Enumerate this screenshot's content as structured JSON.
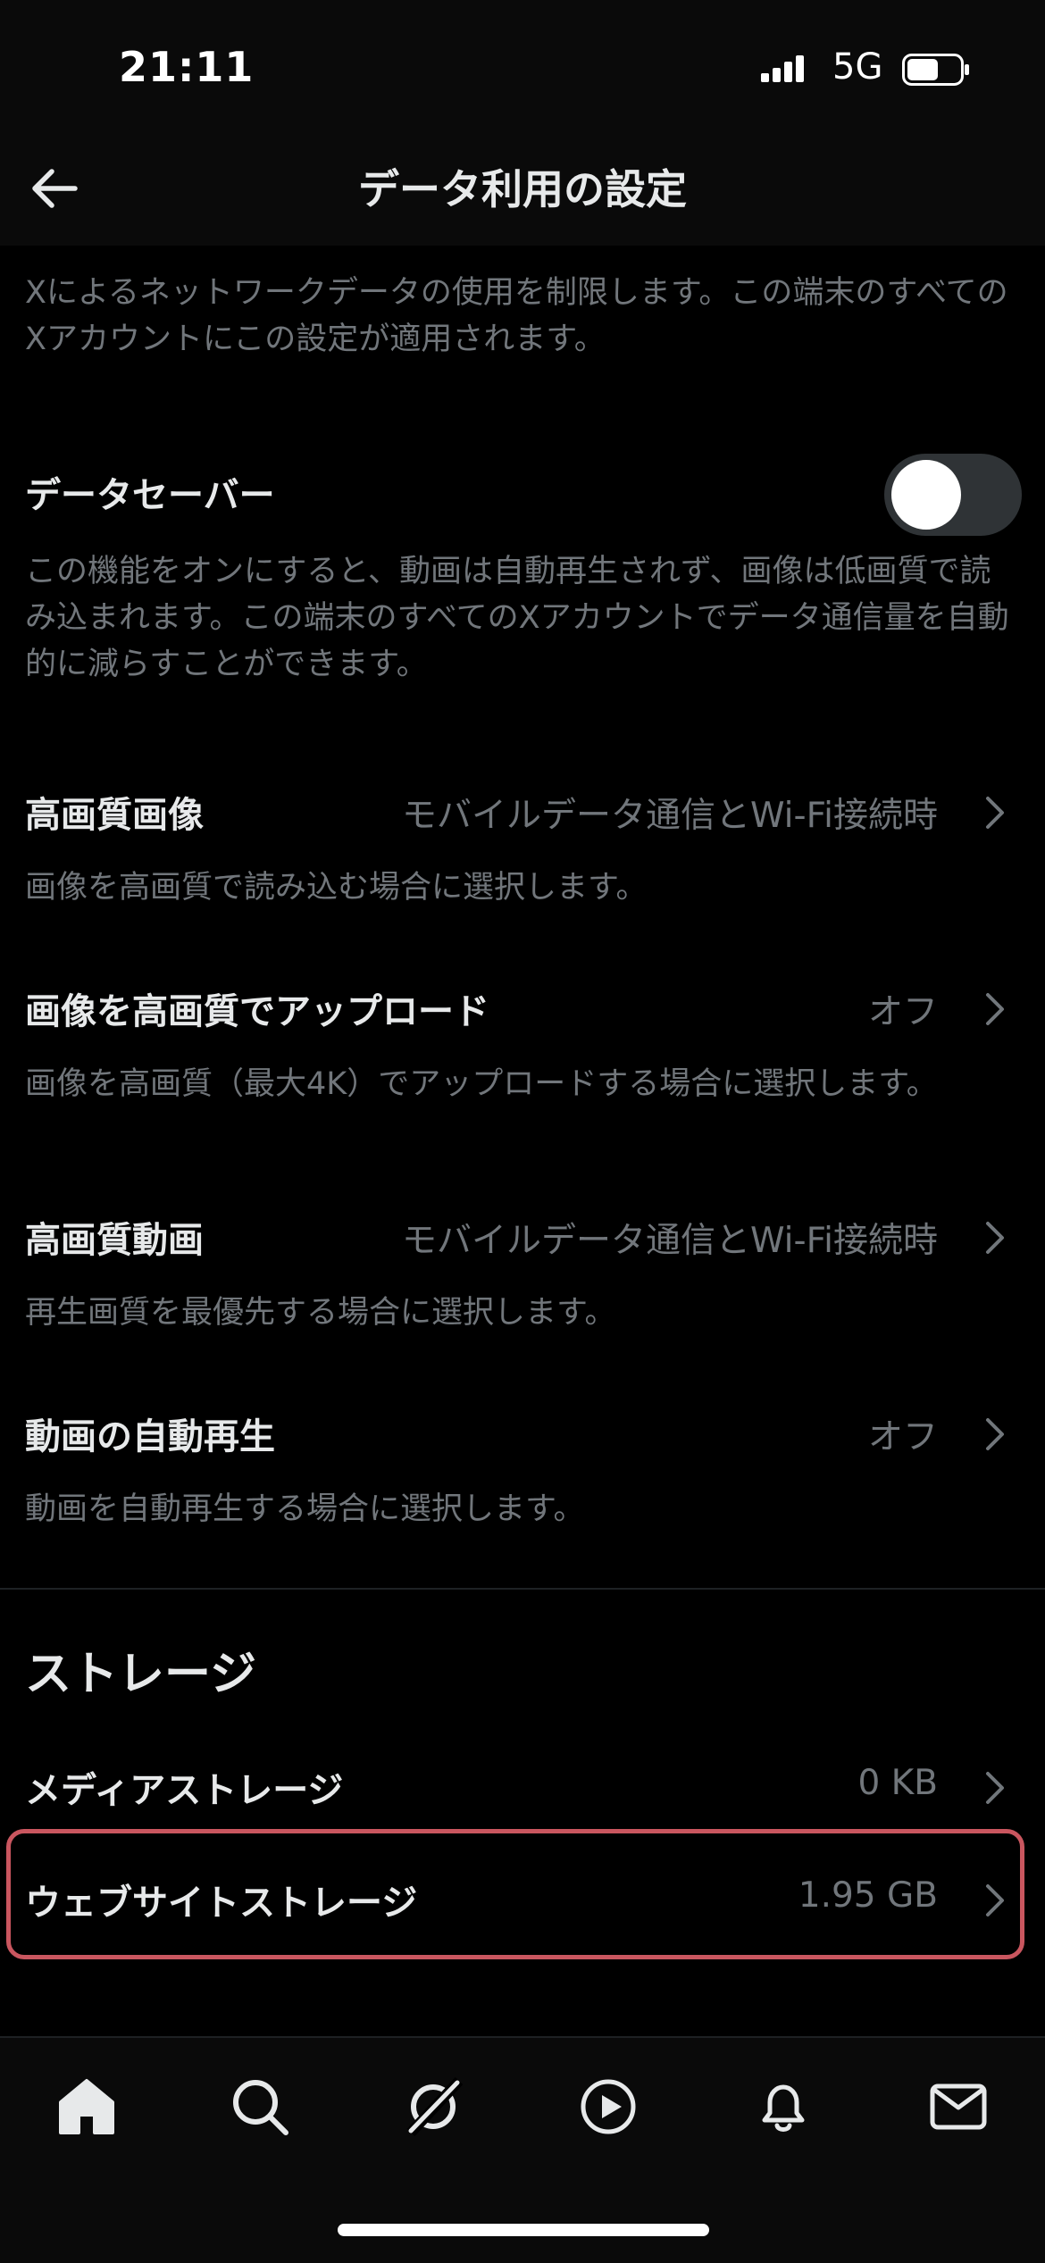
{
  "status": {
    "time": "21:11",
    "network": "5G"
  },
  "header": {
    "title": "データ利用の設定"
  },
  "intro": "Xによるネットワークデータの使用を制限します。この端末のすべてのXアカウントにこの設定が適用されます。",
  "data_saver": {
    "label": "データセーバー",
    "enabled": false,
    "description": "この機能をオンにすると、動画は自動再生されず、画像は低画質で読み込まれます。この端末のすべてのXアカウントでデータ通信量を自動的に減らすことができます。"
  },
  "settings": [
    {
      "label": "高画質画像",
      "value": "モバイルデータ通信とWi-Fi接続時",
      "description": "画像を高画質で読み込む場合に選択します。"
    },
    {
      "label": "画像を高画質でアップロード",
      "value": "オフ",
      "description": "画像を高画質（最大4K）でアップロードする場合に選択します。"
    },
    {
      "label": "高画質動画",
      "value": "モバイルデータ通信とWi-Fi接続時",
      "description": "再生画質を最優先する場合に選択します。"
    },
    {
      "label": "動画の自動再生",
      "value": "オフ",
      "description": "動画を自動再生する場合に選択します。"
    }
  ],
  "storage": {
    "title": "ストレージ",
    "items": [
      {
        "label": "メディアストレージ",
        "value": "0 KB"
      },
      {
        "label": "ウェブサイトストレージ",
        "value": "1.95 GB"
      }
    ]
  },
  "tabs": [
    "home-icon",
    "search-icon",
    "grok-icon",
    "video-icon",
    "notifications-icon",
    "messages-icon"
  ],
  "colors": {
    "background": "#000000",
    "text": "#e7e9ea",
    "secondary": "#71767b",
    "highlight": "#c9565f"
  }
}
